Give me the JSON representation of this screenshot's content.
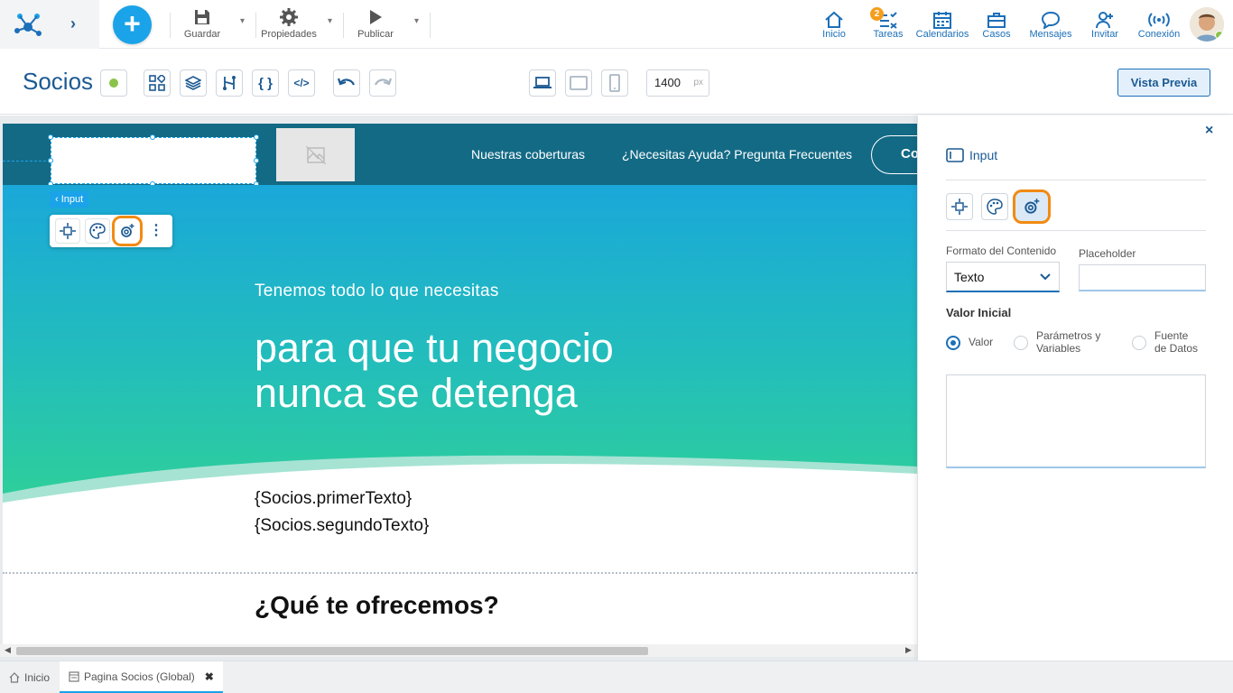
{
  "topbar": {
    "guardar": "Guardar",
    "propiedades": "Propiedades",
    "publicar": "Publicar",
    "nav": {
      "inicio": "Inicio",
      "tareas": "Tareas",
      "tareas_badge": "2",
      "calendarios": "Calendarios",
      "casos": "Casos",
      "mensajes": "Mensajes",
      "invitar": "Invitar",
      "conexion": "Conexión"
    }
  },
  "toolbar": {
    "page_name": "Socios",
    "width_value": "1400",
    "width_unit": "px",
    "preview_label": "Vista Previa"
  },
  "canvas": {
    "nav_link_1": "Nuestras coberturas",
    "nav_link_2": "¿Necesitas Ayuda? Pregunta Frecuentes",
    "nav_cta": "Co",
    "selected_tag": "Input",
    "hero_sub": "Tenemos todo lo que necesitas",
    "hero_title_1": "para que tu negocio",
    "hero_title_2": "nunca se detenga",
    "var_1": "{Socios.primerTexto}",
    "var_2": "{Socios.segundoTexto}",
    "offer_title": "¿Qué te ofrecemos?"
  },
  "panel": {
    "title": "Input",
    "formato_label": "Formato del Contenido",
    "formato_value": "Texto",
    "placeholder_label": "Placeholder",
    "placeholder_value": "",
    "valor_inicial": "Valor Inicial",
    "radio_valor": "Valor",
    "radio_param_1": "Parámetros y",
    "radio_param_2": "Variables",
    "radio_fuente_1": "Fuente",
    "radio_fuente_2": "de Datos",
    "selected_radio": "Valor"
  },
  "bottom_tabs": {
    "inicio": "Inicio",
    "active": "Pagina Socios (Global)"
  },
  "colors": {
    "accent": "#1aa3e8",
    "brand": "#1c5a93",
    "highlight": "#f28a13",
    "site_header": "#136a85"
  }
}
